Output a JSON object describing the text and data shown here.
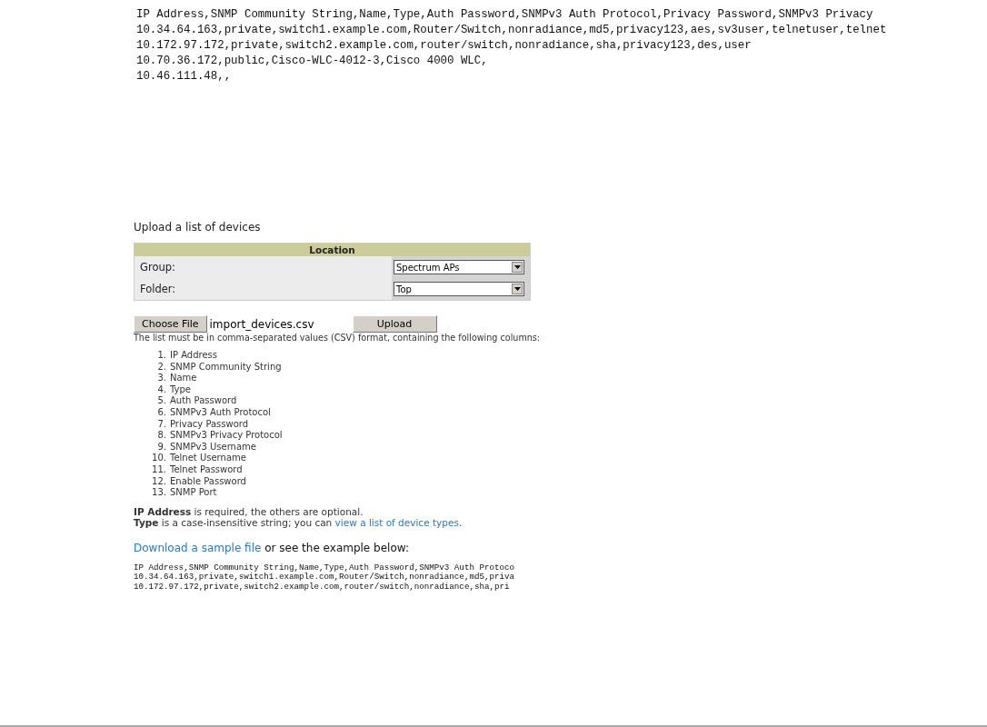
{
  "csv_preview": [
    "IP Address,SNMP Community String,Name,Type,Auth Password,SNMPv3 Auth Protocol,Privacy Password,SNMPv3 Privacy",
    "10.34.64.163,private,switch1.example.com,Router/Switch,nonradiance,md5,privacy123,aes,sv3user,telnetuser,telnet",
    "10.172.97.172,private,switch2.example.com,router/switch,nonradiance,sha,privacy123,des,user",
    "10.70.36.172,public,Cisco-WLC-4012-3,Cisco 4000 WLC,",
    "10.46.111.48,,"
  ],
  "heading": "Upload a list of devices",
  "location": {
    "title": "Location",
    "fields": [
      {
        "label": "Group:",
        "value": "Spectrum APs"
      },
      {
        "label": "Folder:",
        "value": "Top"
      }
    ]
  },
  "upload": {
    "choose_button": "Choose File",
    "file_name": "import_devices.csv",
    "upload_button": "Upload"
  },
  "intro": "The list must be in comma-separated values (CSV) format, containing the following columns:",
  "columns": [
    {
      "number": "1.",
      "name": "IP Address"
    },
    {
      "number": "2.",
      "name": "SNMP Community String"
    },
    {
      "number": "3.",
      "name": "Name"
    },
    {
      "number": "4.",
      "name": "Type"
    },
    {
      "number": "5.",
      "name": "Auth Password"
    },
    {
      "number": "6.",
      "name": "SNMPv3 Auth Protocol"
    },
    {
      "number": "7.",
      "name": "Privacy Password"
    },
    {
      "number": "8.",
      "name": "SNMPv3 Privacy Protocol"
    },
    {
      "number": "9.",
      "name": "SNMPv3 Username"
    },
    {
      "number": "10.",
      "name": "Telnet Username"
    },
    {
      "number": "11.",
      "name": "Telnet Password"
    },
    {
      "number": "12.",
      "name": "Enable Password"
    },
    {
      "number": "13.",
      "name": "SNMP Port"
    }
  ],
  "notes": [
    {
      "text": "**IP Address** is required, the others are optional."
    },
    {
      "text": "**Type** is a case-insensitive string; you can ",
      "link": "view a list of device types",
      "after": "."
    }
  ],
  "download": {
    "link": "Download a sample file",
    "text": "or see the example below:"
  },
  "example": [
    "IP Address,SNMP Community String,Name,Type,Auth Password,SNMPv3 Auth Protoco",
    "10.34.64.163,private,switch1.example.com,Router/Switch,nonradiance,md5,priva",
    "10.172.97.172,private,switch2.example.com,router/switch,nonradiance,sha,pri"
  ]
}
